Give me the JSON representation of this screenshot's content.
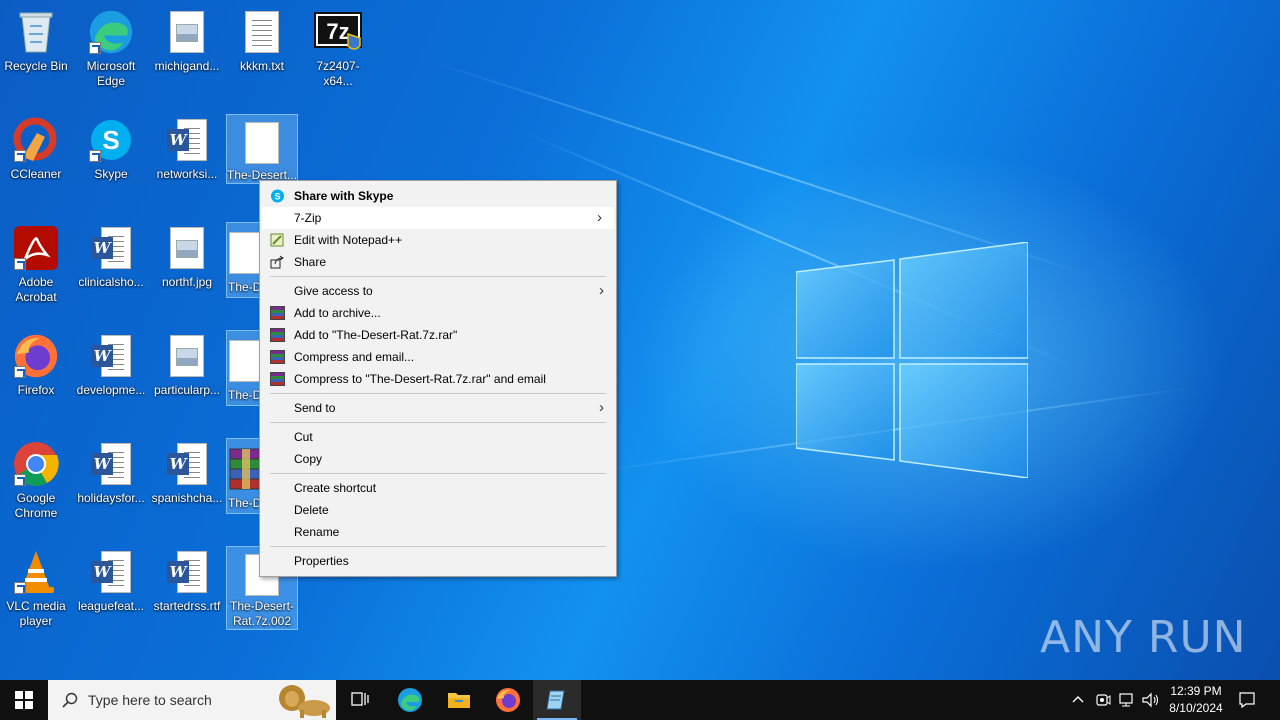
{
  "desktop": {
    "icons": [
      {
        "label": "Recycle Bin",
        "type": "recycle"
      },
      {
        "label": "Microsoft Edge",
        "type": "edge"
      },
      {
        "label": "michigand...",
        "type": "image"
      },
      {
        "label": "kkkm.txt",
        "type": "text"
      },
      {
        "label": "7z2407-x64...",
        "type": "sevenzip"
      },
      {
        "label": "CCleaner",
        "type": "ccleaner"
      },
      {
        "label": "Skype",
        "type": "skype"
      },
      {
        "label": "networksi...",
        "type": "word"
      },
      {
        "label": "The-Desert...",
        "type": "blank"
      },
      {
        "label": "Adobe Acrobat",
        "type": "acrobat"
      },
      {
        "label": "clinicalsho...",
        "type": "word"
      },
      {
        "label": "northf.jpg",
        "type": "image"
      },
      {
        "label": "The-D",
        "type": "blank"
      },
      {
        "label": "Firefox",
        "type": "firefox"
      },
      {
        "label": "developme...",
        "type": "word"
      },
      {
        "label": "particularp...",
        "type": "image"
      },
      {
        "label": "The-D",
        "type": "blank"
      },
      {
        "label": "Google Chrome",
        "type": "chrome"
      },
      {
        "label": "holidaysfor...",
        "type": "word"
      },
      {
        "label": "spanishcha...",
        "type": "word"
      },
      {
        "label": "The-D",
        "type": "rar"
      },
      {
        "label": "VLC media player",
        "type": "vlc"
      },
      {
        "label": "leaguefeat...",
        "type": "word"
      },
      {
        "label": "startedrss.rtf",
        "type": "word"
      },
      {
        "label": "The-Desert-Rat.7z.002",
        "type": "blank"
      }
    ]
  },
  "context_menu": {
    "share_skype": "Share with Skype",
    "seven_zip": "7-Zip",
    "edit_notepad": "Edit with Notepad++",
    "share": "Share",
    "give_access": "Give access to",
    "add_archive": "Add to archive...",
    "add_to_rar": "Add to \"The-Desert-Rat.7z.rar\"",
    "compress_email": "Compress and email...",
    "compress_to_rar_email": "Compress to \"The-Desert-Rat.7z.rar\" and email",
    "send_to": "Send to",
    "cut": "Cut",
    "copy": "Copy",
    "create_shortcut": "Create shortcut",
    "delete": "Delete",
    "rename": "Rename",
    "properties": "Properties"
  },
  "taskbar": {
    "search_placeholder": "Type here to search",
    "time": "12:39 PM",
    "date": "8/10/2024"
  },
  "watermark": "ANY RUN",
  "colors": {
    "taskbar_bg": "#101010",
    "menu_bg": "#f2f2f2",
    "accent": "#0078d7"
  }
}
